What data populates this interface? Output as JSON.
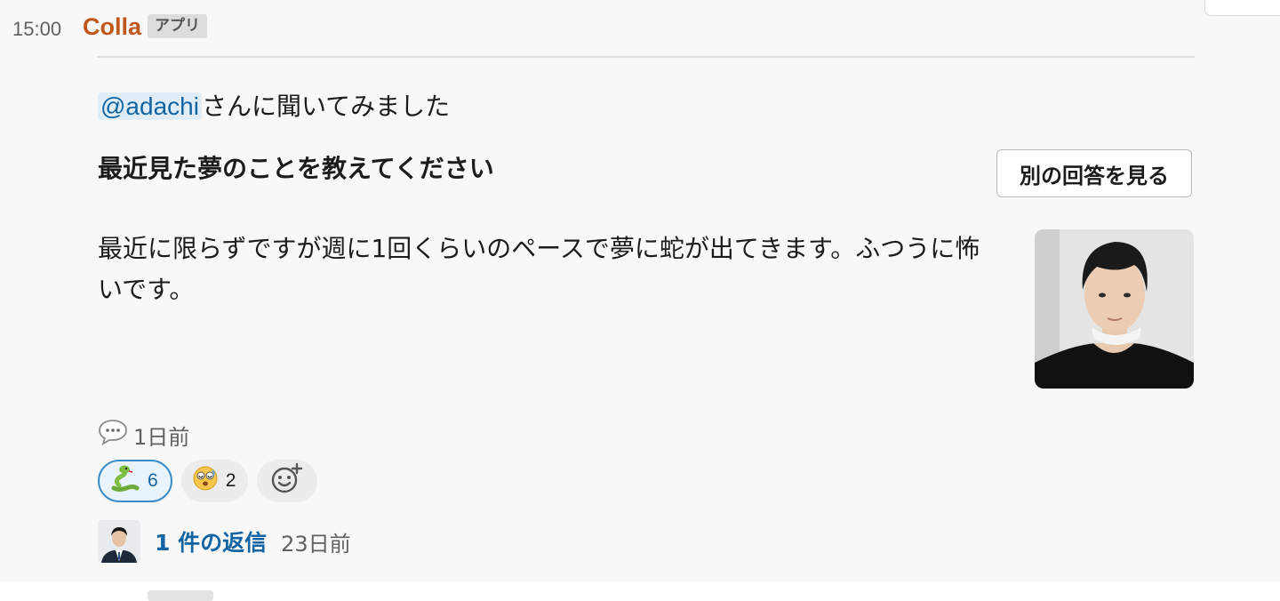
{
  "message": {
    "time": "15:00",
    "sender": "Colla",
    "app_badge": "アプリ",
    "mention": "@adachi",
    "intro_text": "さんに聞いてみました",
    "question": "最近見た夢のことを教えてください",
    "other_answer_button": "別の回答を見る",
    "answer": "最近に限らずですが週に1回くらいのペースで夢に蛇が出てきます。ふつうに怖いです。",
    "answer_age": "1日前"
  },
  "reactions": [
    {
      "emoji": "snake",
      "count": "6",
      "selected": true
    },
    {
      "emoji": "dizzy-face",
      "count": "2",
      "selected": false
    }
  ],
  "thread": {
    "reply_label": "1 件の返信",
    "last_reply_age": "23日前"
  },
  "colors": {
    "sender": "#c2571d",
    "link": "#1264a3",
    "mention_bg": "#e0edf7",
    "selected_reaction_border": "#3a8bc6"
  },
  "icons": {
    "speech": "speech-bubble-icon",
    "add_reaction": "add-reaction-icon"
  }
}
